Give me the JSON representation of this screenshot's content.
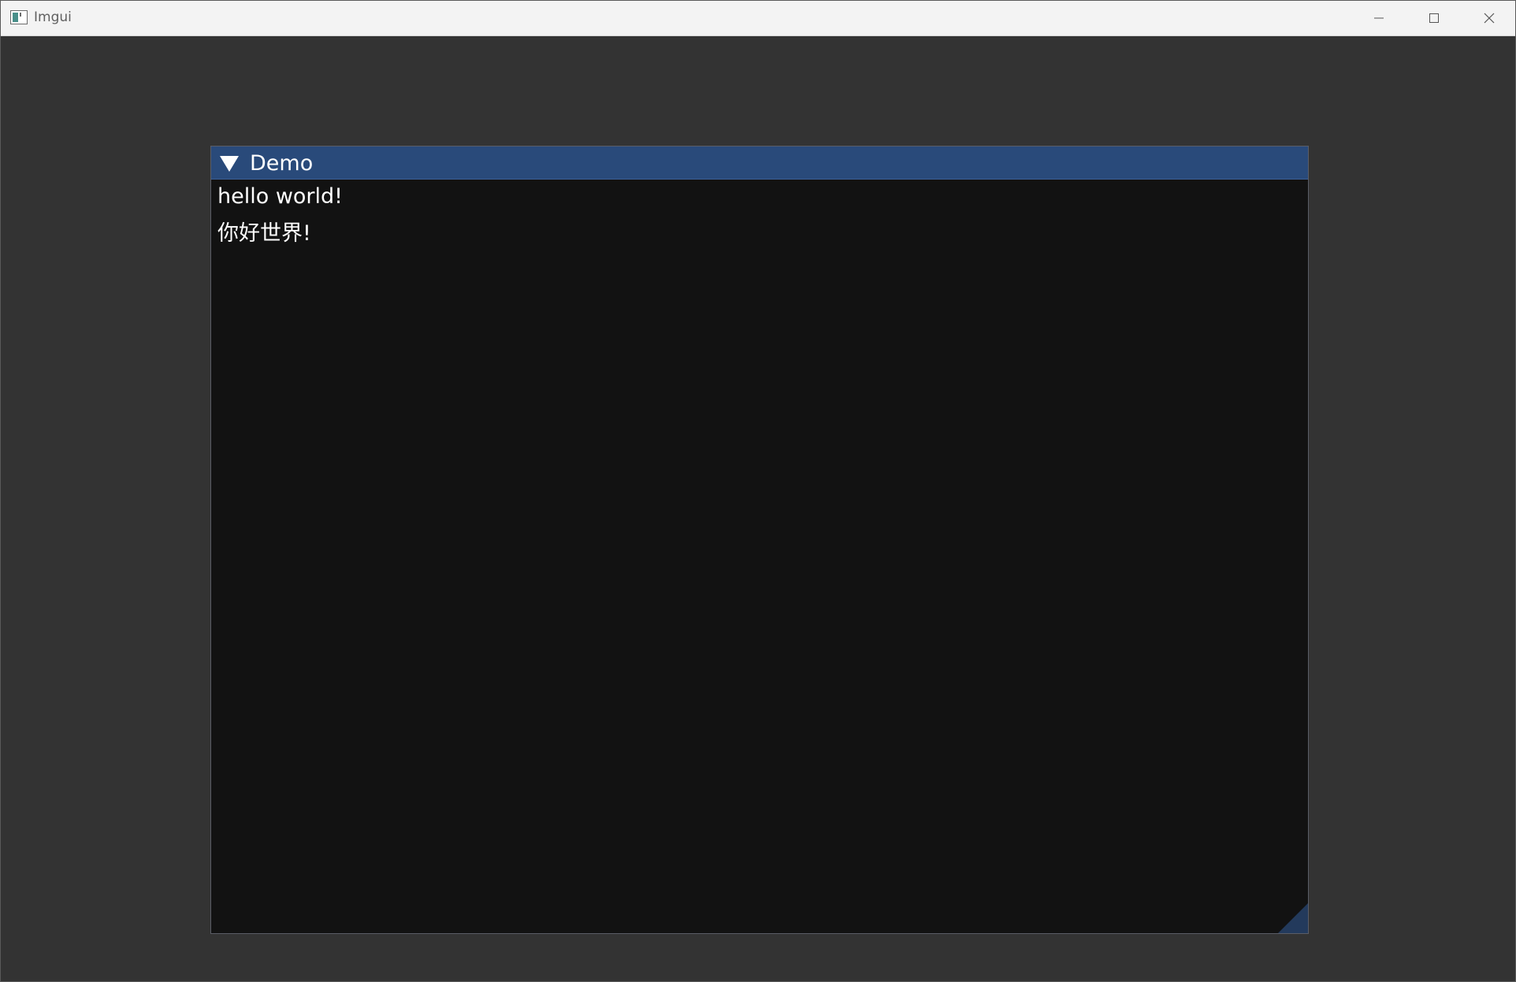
{
  "os_window": {
    "title": "Imgui",
    "controls": {
      "minimize": "minimize-icon",
      "maximize": "maximize-icon",
      "close": "close-icon"
    }
  },
  "imgui_window": {
    "title": "Demo",
    "collapsed": false,
    "lines": [
      "hello world!",
      "你好世界!"
    ]
  },
  "colors": {
    "client_background": "#333333",
    "window_background": "#121212",
    "title_active": "#294a7a",
    "text": "#ffffff",
    "resize_grip": "#233a5c"
  }
}
